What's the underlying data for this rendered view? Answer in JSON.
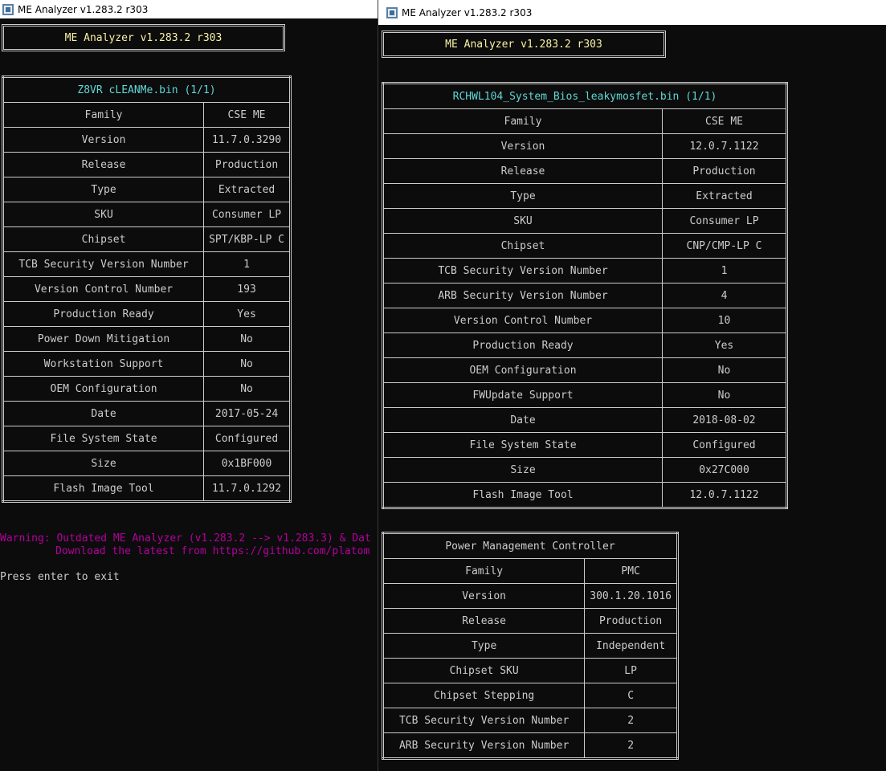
{
  "left_window": {
    "title": "ME Analyzer v1.283.2 r303",
    "banner": "ME Analyzer v1.283.2 r303",
    "table": {
      "header": "Z8VR cLEANMe.bin (1/1)",
      "rows": [
        [
          "Family",
          "CSE ME"
        ],
        [
          "Version",
          "11.7.0.3290"
        ],
        [
          "Release",
          "Production"
        ],
        [
          "Type",
          "Extracted"
        ],
        [
          "SKU",
          "Consumer LP"
        ],
        [
          "Chipset",
          "SPT/KBP-LP C"
        ],
        [
          "TCB Security Version Number",
          "1"
        ],
        [
          "Version Control Number",
          "193"
        ],
        [
          "Production Ready",
          "Yes"
        ],
        [
          "Power Down Mitigation",
          "No"
        ],
        [
          "Workstation Support",
          "No"
        ],
        [
          "OEM Configuration",
          "No"
        ],
        [
          "Date",
          "2017-05-24"
        ],
        [
          "File System State",
          "Configured"
        ],
        [
          "Size",
          "0x1BF000"
        ],
        [
          "Flash Image Tool",
          "11.7.0.1292"
        ]
      ]
    },
    "warning_line1": "Warning: Outdated ME Analyzer (v1.283.2 --> v1.283.3) & Dat",
    "warning_line2": "Download the latest from https://github.com/platom",
    "prompt": "Press enter to exit"
  },
  "right_window": {
    "title": "ME Analyzer v1.283.2 r303",
    "banner": "ME Analyzer v1.283.2 r303",
    "table": {
      "header": "RCHWL104_System_Bios_leakymosfet.bin (1/1)",
      "rows": [
        [
          "Family",
          "CSE ME"
        ],
        [
          "Version",
          "12.0.7.1122"
        ],
        [
          "Release",
          "Production"
        ],
        [
          "Type",
          "Extracted"
        ],
        [
          "SKU",
          "Consumer LP"
        ],
        [
          "Chipset",
          "CNP/CMP-LP C"
        ],
        [
          "TCB Security Version Number",
          "1"
        ],
        [
          "ARB Security Version Number",
          "4"
        ],
        [
          "Version Control Number",
          "10"
        ],
        [
          "Production Ready",
          "Yes"
        ],
        [
          "OEM Configuration",
          "No"
        ],
        [
          "FWUpdate Support",
          "No"
        ],
        [
          "Date",
          "2018-08-02"
        ],
        [
          "File System State",
          "Configured"
        ],
        [
          "Size",
          "0x27C000"
        ],
        [
          "Flash Image Tool",
          "12.0.7.1122"
        ]
      ]
    },
    "pmc_table": {
      "header": "Power Management Controller",
      "rows": [
        [
          "Family",
          "PMC"
        ],
        [
          "Version",
          "300.1.20.1016"
        ],
        [
          "Release",
          "Production"
        ],
        [
          "Type",
          "Independent"
        ],
        [
          "Chipset SKU",
          "LP"
        ],
        [
          "Chipset Stepping",
          "C"
        ],
        [
          "TCB Security Version Number",
          "2"
        ],
        [
          "ARB Security Version Number",
          "2"
        ]
      ]
    }
  },
  "colors": {
    "background": "#0c0c0c",
    "text": "#cccccc",
    "banner_text": "#f9f1a5",
    "header_text": "#61d6d6",
    "warning_text": "#b4009e"
  }
}
